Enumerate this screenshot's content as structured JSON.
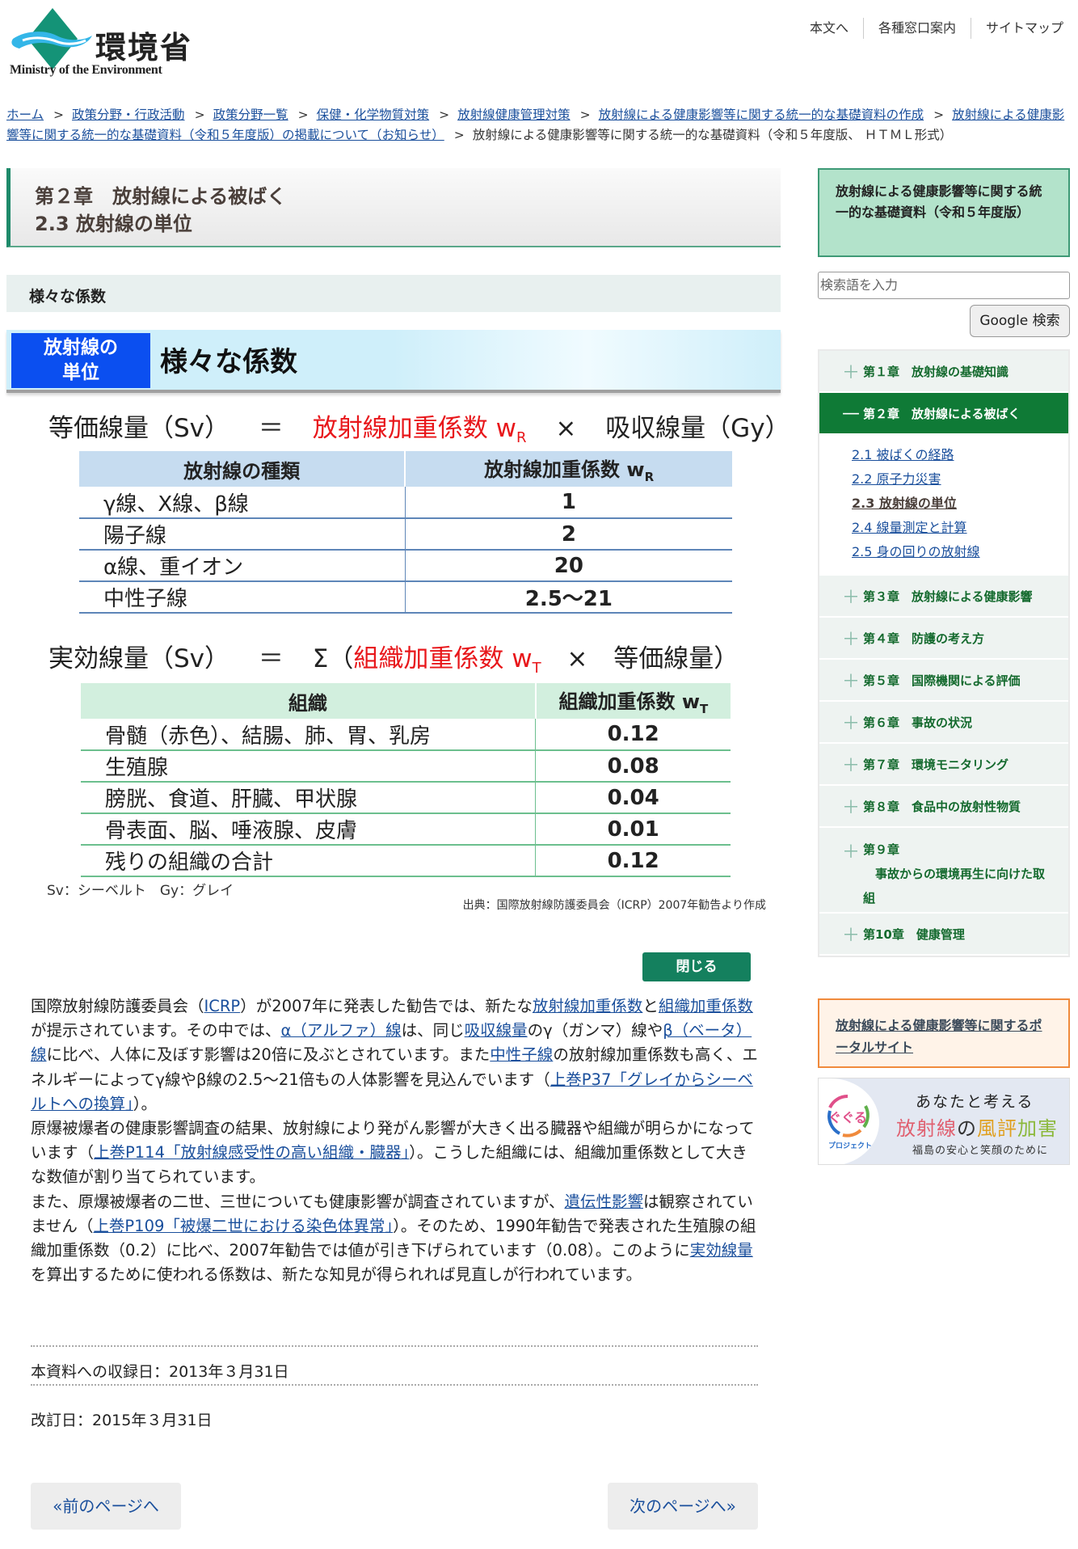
{
  "header": {
    "logo_kanji": "環境省",
    "logo_en": "Ministry of the Environment",
    "utility_nav": [
      "本文へ",
      "各種窓口案内",
      "サイトマップ"
    ]
  },
  "breadcrumb": {
    "links": [
      "ホーム",
      "政策分野・行政活動",
      "政策分野一覧",
      "保健・化学物質対策",
      "放射線健康管理対策",
      "放射線による健康影響等に関する統一的な基礎資料の作成",
      "放射線による健康影響等に関する統一的な基礎資料（令和５年度版）の掲載について（お知らせ）"
    ],
    "current": "放射線による健康影響等に関する統一的な基礎資料（令和５年度版、 ＨＴＭＬ形式）",
    "separator": ">"
  },
  "main": {
    "chapter_line1": "第２章　放射線による被ばく",
    "chapter_line2": "2.3 放射線の単位",
    "section_title": "様々な係数",
    "figure": {
      "badge_line1": "放射線の",
      "badge_line2": "単位",
      "title": "様々な係数",
      "formula1": {
        "lhs": "等価線量（Sv）",
        "eq": "＝",
        "factor": "放射線加重係数 w",
        "factor_sub": "R",
        "times": "×",
        "rhs": "吸収線量（Gy）"
      },
      "table1": {
        "headers": [
          "放射線の種類",
          "放射線加重係数 w"
        ],
        "header_sub": "R",
        "rows": [
          [
            "γ線、X線、β線",
            "1"
          ],
          [
            "陽子線",
            "2"
          ],
          [
            "α線、重イオン",
            "20"
          ],
          [
            "中性子線",
            "2.5〜21"
          ]
        ]
      },
      "formula2": {
        "lhs": "実効線量（Sv）",
        "eq": "＝",
        "sigma": "Σ（",
        "factor": "組織加重係数 w",
        "factor_sub": "T",
        "times": "×",
        "rhs": "等価線量）"
      },
      "table2": {
        "headers": [
          "組織",
          "組織加重係数 w"
        ],
        "header_sub": "T",
        "rows": [
          [
            "骨髄（赤色）、結腸、肺、胃、乳房",
            "0.12"
          ],
          [
            "生殖腺",
            "0.08"
          ],
          [
            "膀胱、食道、肝臓、甲状腺",
            "0.04"
          ],
          [
            "骨表面、脳、唾液腺、皮膚",
            "0.01"
          ],
          [
            "残りの組織の合計",
            "0.12"
          ]
        ]
      },
      "abbr_note": "Sv：シーベルト　Gy：グレイ",
      "source": "出典：国際放射線防護委員会（ICRP）2007年勧告より作成"
    },
    "close_button": "閉じる",
    "paragraph1": [
      {
        "t": "国際放射線防護委員会（"
      },
      {
        "a": "ICRP"
      },
      {
        "t": "）が2007年に発表した勧告では、新たな"
      },
      {
        "a": "放射線加重係数"
      },
      {
        "t": "と"
      },
      {
        "a": "組織加重係数"
      },
      {
        "t": "が提示されています。その中では、"
      },
      {
        "a": "α（アルファ）線"
      },
      {
        "t": "は、同じ"
      },
      {
        "a": "吸収線量"
      },
      {
        "t": "のγ（ガンマ）線や"
      },
      {
        "a": "β（ベータ）線"
      },
      {
        "t": "に比べ、人体に及ぼす影響は20倍に及ぶとされています。また"
      },
      {
        "a": "中性子線"
      },
      {
        "t": "の放射線加重係数も高く、エネルギーによってγ線やβ線の2.5〜21倍もの人体影響を見込んでいます（"
      },
      {
        "a": "上巻P37「グレイからシーベルトへの換算」"
      },
      {
        "t": "）。"
      }
    ],
    "paragraph2": [
      {
        "t": "原爆被爆者の健康影響調査の結果、放射線により発がん影響が大きく出る臓器や組織が明らかになっています（"
      },
      {
        "a": "上巻P114「放射線感受性の高い組織・臓器」"
      },
      {
        "t": "）。こうした組織には、組織加重係数として大きな数値が割り当てられています。"
      }
    ],
    "paragraph3": [
      {
        "t": "また、原爆被爆者の二世、三世についても健康影響が調査されていますが、"
      },
      {
        "a": "遺伝性影響"
      },
      {
        "t": "は観察されていません（"
      },
      {
        "a": "上巻P109「被爆二世における染色体異常」"
      },
      {
        "t": "）。そのため、1990年勧告で発表された生殖腺の組織加重係数（0.2）に比べ、2007年勧告では値が引き下げられています（0.08）。このように"
      },
      {
        "a": "実効線量"
      },
      {
        "t": "を算出するために使われる係数は、新たな知見が得られれば見直しが行われています。"
      }
    ],
    "recorded_date": "本資料への収録日：2013年３月31日",
    "revised_date": "改訂日：2015年３月31日",
    "prev_page": "«前のページへ",
    "next_page": "次のページへ»"
  },
  "sidebar": {
    "title": "放射線による健康影響等に関する統一的な基礎資料（令和５年度版）",
    "search_placeholder": "検索語を入力",
    "search_button": "Google 検索",
    "chapters": [
      {
        "label": "第１章　放射線の基礎知識",
        "expanded": false
      },
      {
        "label": "第２章　放射線による被ばく",
        "expanded": true
      },
      {
        "label": "第３章　放射線による健康影響",
        "expanded": false
      },
      {
        "label": "第４章　防護の考え方",
        "expanded": false
      },
      {
        "label": "第５章　国際機関による評価",
        "expanded": false
      },
      {
        "label": "第６章　事故の状況",
        "expanded": false
      },
      {
        "label": "第７章　環境モニタリング",
        "expanded": false
      },
      {
        "label": "第８章　食品中の放射性物質",
        "expanded": false
      },
      {
        "label": "第９章\n　事故からの環境再生に向けた取\n組",
        "expanded": false
      },
      {
        "label": "第10章　健康管理",
        "expanded": false
      }
    ],
    "subsections": [
      {
        "label": "2.1 被ばくの経路",
        "current": false
      },
      {
        "label": "2.2 原子力災害",
        "current": false
      },
      {
        "label": "2.3 放射線の単位",
        "current": true
      },
      {
        "label": "2.4 線量測定と計算",
        "current": false
      },
      {
        "label": "2.5 身の回りの放射線",
        "current": false
      }
    ],
    "expand_symbol": "＋",
    "collapse_symbol": "—",
    "portal_link": "放射線による健康影響等に関するポータルサイト",
    "banner": {
      "logo_text": "ぐぐる",
      "project": "プロジェクト",
      "line1": "あなたと考える",
      "line2_parts": [
        {
          "text": "放射線",
          "color": "#e06070"
        },
        {
          "text": "の",
          "color": "#333333"
        },
        {
          "text": "風評",
          "color": "#e0a020"
        },
        {
          "text": "加害",
          "color": "#8bb83a"
        }
      ],
      "line3": "福島の安心と笑顔のために"
    }
  },
  "colors": {
    "brand_green": "#0f7a36",
    "link_blue": "#1a4f9c",
    "formula_red": "#e8171b",
    "badge_blue": "#0b4ff0",
    "close_button": "#14805e",
    "portal_border": "#f08a3c"
  }
}
